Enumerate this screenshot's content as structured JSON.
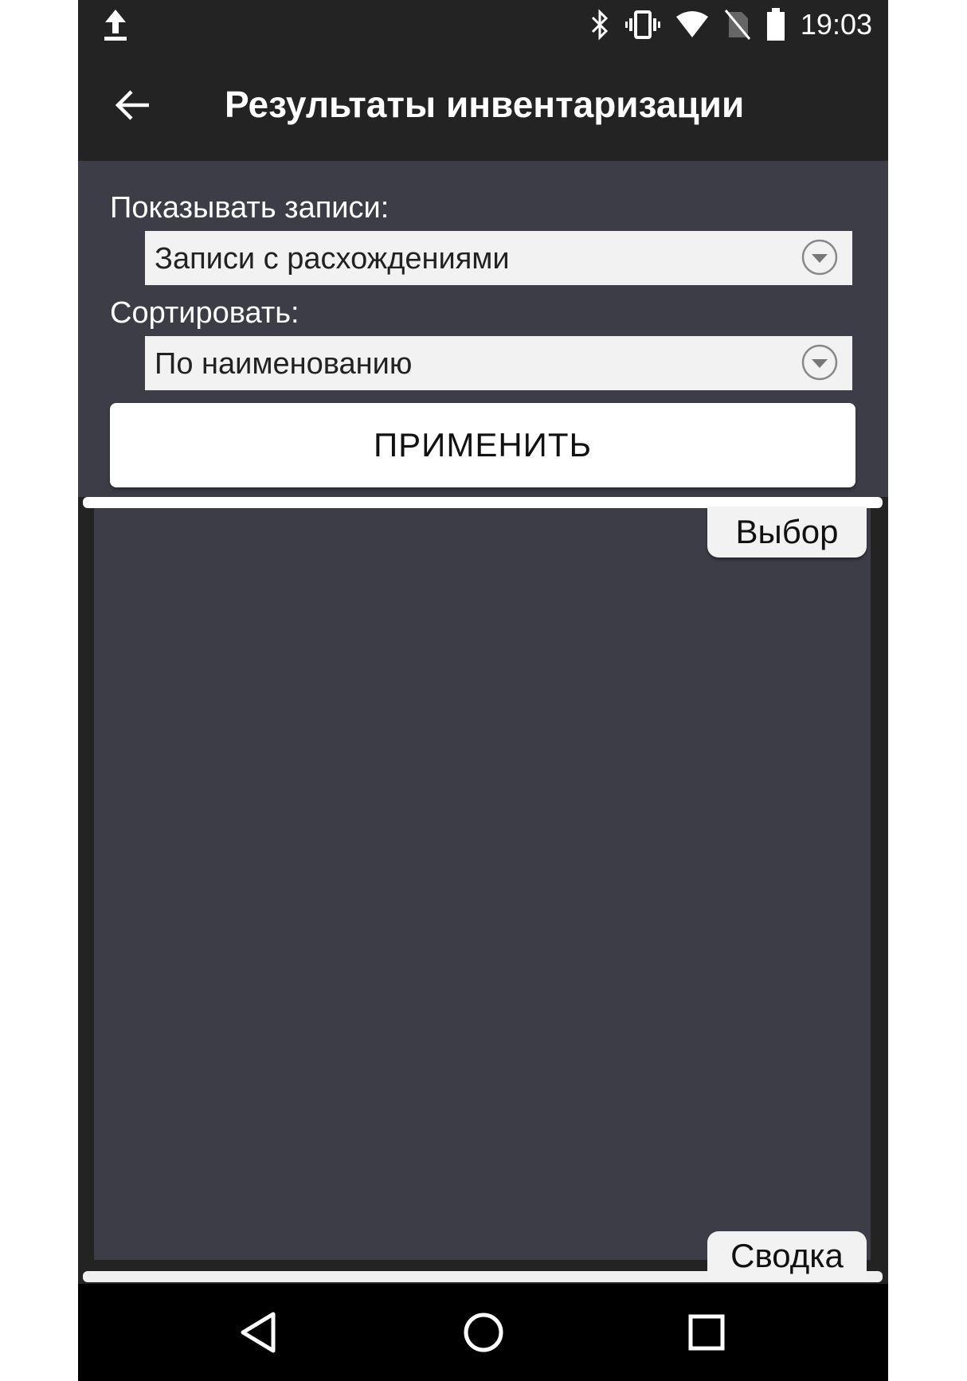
{
  "status_bar": {
    "time": "19:03",
    "icons": [
      "upload-icon",
      "bluetooth-icon",
      "vibrate-icon",
      "wifi-icon",
      "no-sim-icon",
      "battery-icon"
    ]
  },
  "app_bar": {
    "title": "Результаты инвентаризации",
    "back_icon": "arrow-left-icon"
  },
  "filters": {
    "show_label": "Показывать записи:",
    "show_value": "Записи с расхождениями",
    "sort_label": "Сортировать:",
    "sort_value": "По наименованию",
    "apply_label": "ПРИМЕНИТЬ"
  },
  "tabs": {
    "top": "Выбор",
    "bottom": "Сводка"
  },
  "nav_bar": {
    "icons": [
      "back-triangle-icon",
      "home-circle-icon",
      "recents-square-icon"
    ]
  }
}
